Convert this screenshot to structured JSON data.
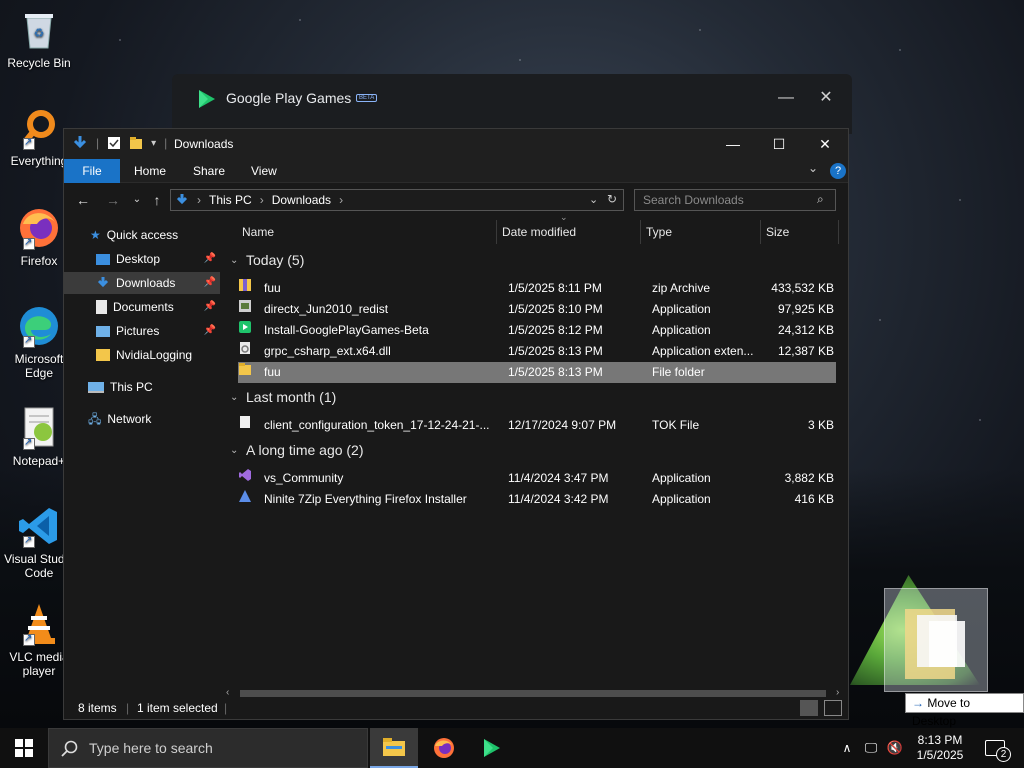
{
  "desktop": {
    "icons": [
      {
        "label": "Recycle Bin"
      },
      {
        "label": "Everything"
      },
      {
        "label": "Firefox"
      },
      {
        "label": "Microsoft Edge"
      },
      {
        "label": "Notepad+"
      },
      {
        "label": "Visual Studio Code"
      },
      {
        "label": "VLC media player"
      }
    ]
  },
  "gpg_window": {
    "title": "Google Play Games",
    "badge": "BETA"
  },
  "explorer": {
    "title": "Downloads",
    "ribbon": {
      "file": "File",
      "home": "Home",
      "share": "Share",
      "view": "View"
    },
    "address": {
      "crumbs": [
        "This PC",
        "Downloads"
      ]
    },
    "search": {
      "placeholder": "Search Downloads"
    },
    "nav": [
      {
        "label": "Quick access"
      },
      {
        "label": "Desktop"
      },
      {
        "label": "Downloads"
      },
      {
        "label": "Documents"
      },
      {
        "label": "Pictures"
      },
      {
        "label": "NvidiaLogging"
      },
      {
        "label": "This PC"
      },
      {
        "label": "Network"
      }
    ],
    "columns": {
      "name": "Name",
      "date": "Date modified",
      "type": "Type",
      "size": "Size"
    },
    "groups": [
      {
        "label": "Today (5)"
      },
      {
        "label": "Last month (1)"
      },
      {
        "label": "A long time ago (2)"
      }
    ],
    "files": [
      {
        "name": "fuu",
        "date": "1/5/2025 8:11 PM",
        "type": "zip Archive",
        "size": "433,532 KB"
      },
      {
        "name": "directx_Jun2010_redist",
        "date": "1/5/2025 8:10 PM",
        "type": "Application",
        "size": "97,925 KB"
      },
      {
        "name": "Install-GooglePlayGames-Beta",
        "date": "1/5/2025 8:12 PM",
        "type": "Application",
        "size": "24,312 KB"
      },
      {
        "name": "grpc_csharp_ext.x64.dll",
        "date": "1/5/2025 8:13 PM",
        "type": "Application exten...",
        "size": "12,387 KB"
      },
      {
        "name": "fuu",
        "date": "1/5/2025 8:13 PM",
        "type": "File folder",
        "size": ""
      },
      {
        "name": "client_configuration_token_17-12-24-21-...",
        "date": "12/17/2024 9:07 PM",
        "type": "TOK File",
        "size": "3 KB"
      },
      {
        "name": "vs_Community",
        "date": "11/4/2024 3:47 PM",
        "type": "Application",
        "size": "3,882 KB"
      },
      {
        "name": "Ninite 7Zip Everything Firefox Installer",
        "date": "11/4/2024 3:42 PM",
        "type": "Application",
        "size": "416 KB"
      }
    ],
    "status": {
      "items": "8 items",
      "selected": "1 item selected"
    }
  },
  "drag": {
    "tip": "Move to Desktop",
    "arrow": "→"
  },
  "taskbar": {
    "search_placeholder": "Type here to search",
    "time": "8:13 PM",
    "date": "1/5/2025",
    "notifications": "2"
  },
  "colors": {
    "accent": "#1a73c7",
    "selection": "#777777",
    "explorer_bg": "#191919"
  }
}
